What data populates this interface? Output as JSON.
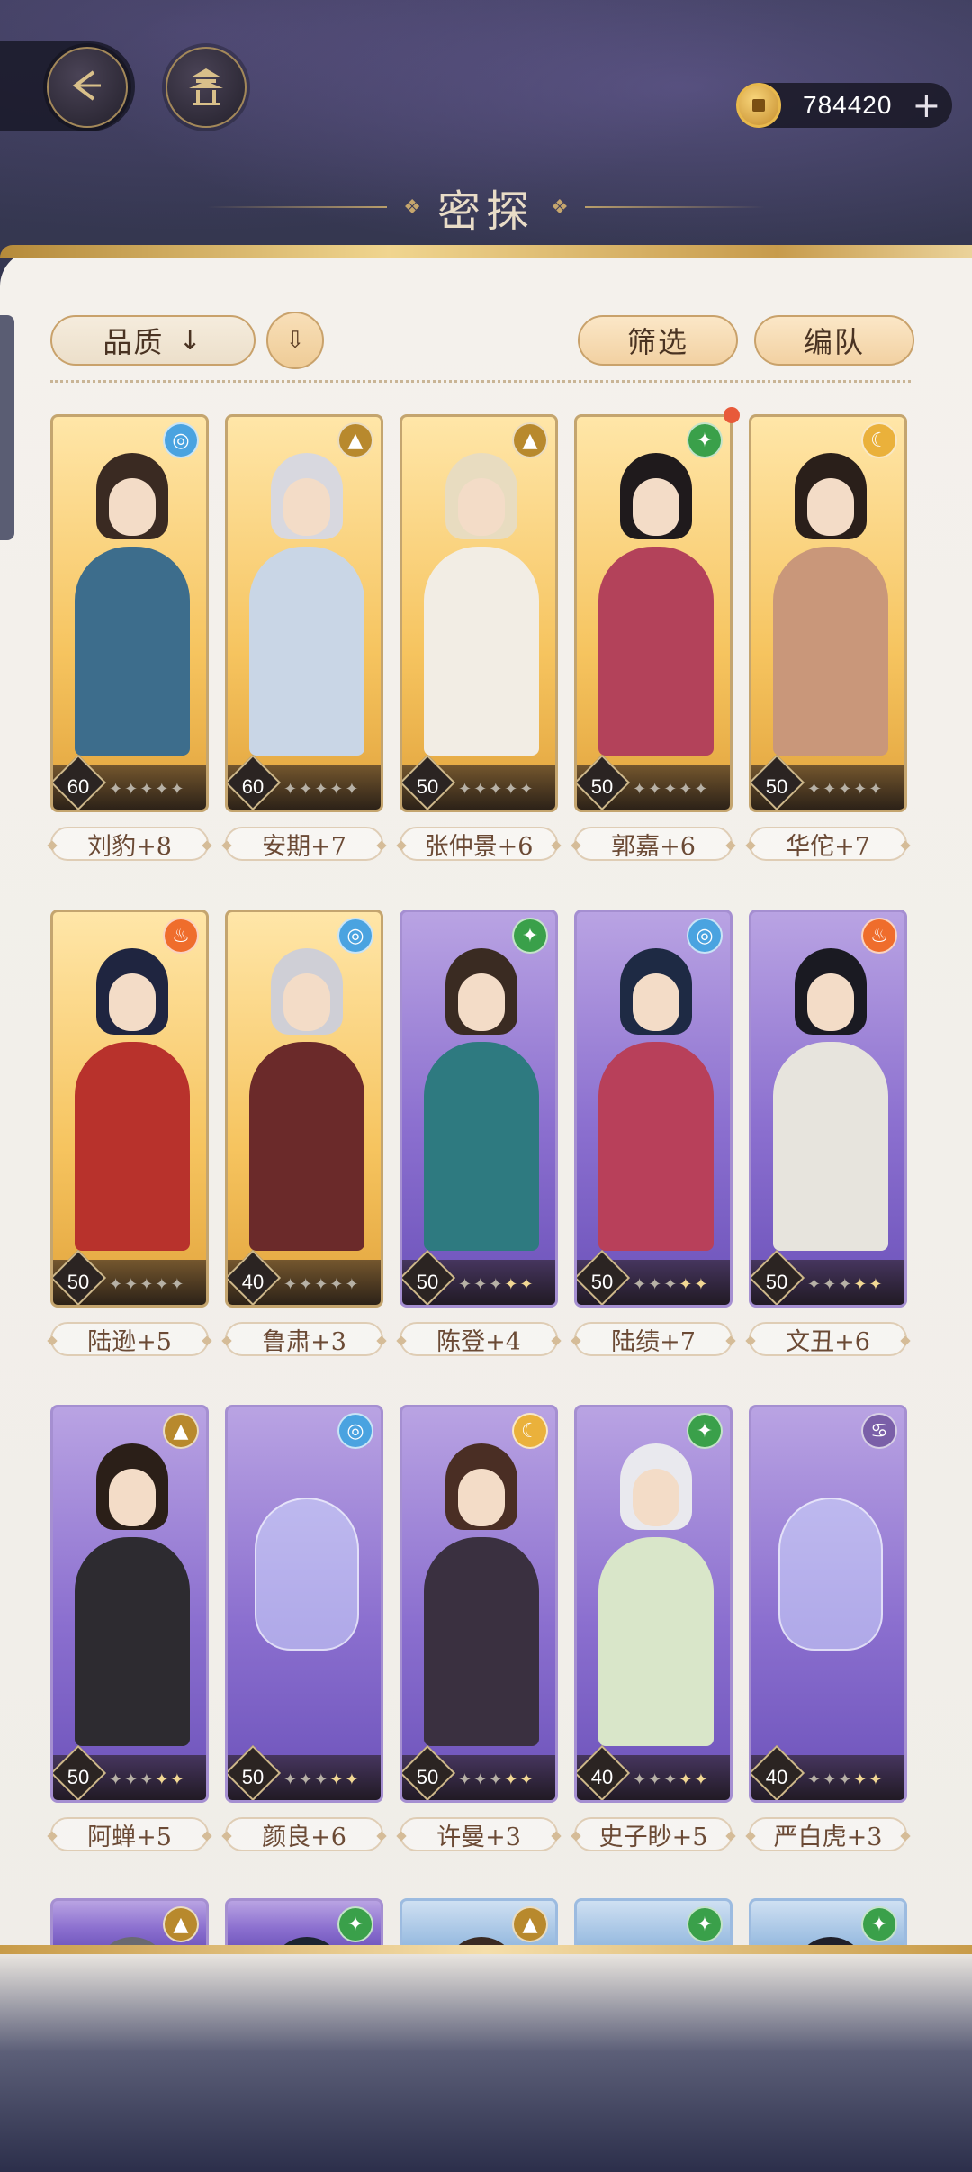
{
  "header": {
    "title": "密探",
    "currency_value": "784420",
    "currency_plus": "+",
    "back_icon": "back-arrow-icon",
    "home_icon": "pavilion-icon"
  },
  "toolbar": {
    "sort_label": "品质",
    "sort_arrow": "↓",
    "order_toggle": "⇩",
    "filter_label": "筛选",
    "team_label": "编队"
  },
  "colors": {
    "gold_frame": "#f6c45f",
    "purple_frame": "#8b6fcf",
    "blue_frame": "#8fb5dd",
    "accent": "#c9a26b"
  },
  "cards": [
    {
      "name": "刘豹+8",
      "level": "60",
      "rarity": "gold",
      "element": "water",
      "stars": 0
    },
    {
      "name": "安期+7",
      "level": "60",
      "rarity": "gold",
      "element": "mountain",
      "stars": 0
    },
    {
      "name": "张仲景+6",
      "level": "50",
      "rarity": "gold",
      "element": "mountain",
      "stars": 0
    },
    {
      "name": "郭嘉+6",
      "level": "50",
      "rarity": "gold",
      "element": "wind",
      "stars": 0,
      "new": true
    },
    {
      "name": "华佗+7",
      "level": "50",
      "rarity": "gold",
      "element": "moon",
      "stars": 0
    },
    {
      "name": "陆逊+5",
      "level": "50",
      "rarity": "gold",
      "element": "fire",
      "stars": 0
    },
    {
      "name": "鲁肃+3",
      "level": "40",
      "rarity": "gold",
      "element": "water",
      "stars": 0
    },
    {
      "name": "陈登+4",
      "level": "50",
      "rarity": "purple",
      "element": "wind",
      "stars": 2
    },
    {
      "name": "陆绩+7",
      "level": "50",
      "rarity": "purple",
      "element": "water",
      "stars": 2
    },
    {
      "name": "文丑+6",
      "level": "50",
      "rarity": "purple",
      "element": "fire",
      "stars": 2
    },
    {
      "name": "阿蝉+5",
      "level": "50",
      "rarity": "purple",
      "element": "mountain",
      "stars": 2
    },
    {
      "name": "颜良+6",
      "level": "50",
      "rarity": "purple",
      "element": "water",
      "stars": 2
    },
    {
      "name": "许曼+3",
      "level": "50",
      "rarity": "purple",
      "element": "moon",
      "stars": 2
    },
    {
      "name": "史子眇+5",
      "level": "40",
      "rarity": "purple",
      "element": "wind",
      "stars": 2
    },
    {
      "name": "严白虎+3",
      "level": "40",
      "rarity": "purple",
      "element": "crab",
      "stars": 2
    },
    {
      "name": "",
      "level": "",
      "rarity": "purple",
      "element": "mountain",
      "stars": 0
    },
    {
      "name": "",
      "level": "",
      "rarity": "purple",
      "element": "wind",
      "stars": 0
    },
    {
      "name": "",
      "level": "",
      "rarity": "blue",
      "element": "mountain",
      "stars": 0
    },
    {
      "name": "",
      "level": "",
      "rarity": "blue",
      "element": "wind",
      "stars": 0
    },
    {
      "name": "",
      "level": "",
      "rarity": "blue",
      "element": "wind",
      "stars": 0
    }
  ]
}
